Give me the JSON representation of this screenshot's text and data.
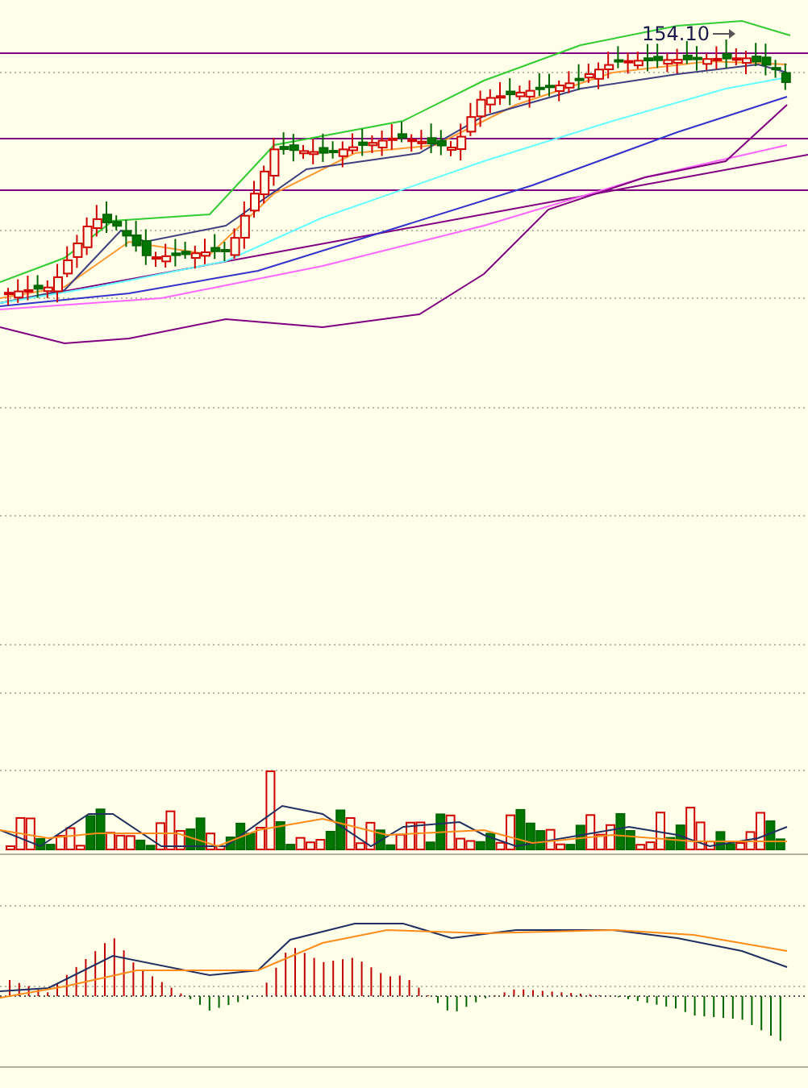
{
  "price_chart": {
    "peak_label": "154.10"
  }
}
